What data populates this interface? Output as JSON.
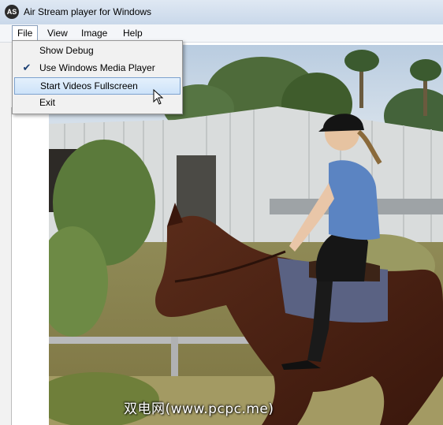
{
  "window": {
    "title": "Air Stream player for Windows",
    "icon_text": "AS"
  },
  "menubar": {
    "items": [
      "File",
      "View",
      "Image",
      "Help"
    ]
  },
  "file_menu": {
    "items": [
      {
        "label": "Show Debug",
        "checked": false,
        "highlighted": false
      },
      {
        "label": "Use Windows Media Player",
        "checked": true,
        "highlighted": false
      },
      {
        "label": "Start Videos Fullscreen",
        "checked": false,
        "highlighted": true
      },
      {
        "label": "Exit",
        "checked": false,
        "highlighted": false
      }
    ]
  },
  "video": {
    "watermark": "双电网(www.pcpc.me)"
  },
  "colors": {
    "menu_highlight": "#cde3f9",
    "title_bar": "#dfe8f3"
  }
}
